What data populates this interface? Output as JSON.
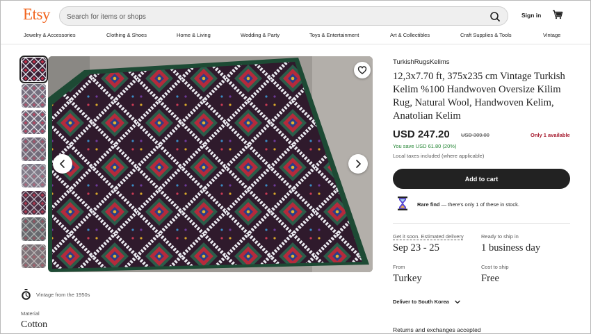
{
  "header": {
    "logo": "Etsy",
    "search_placeholder": "Search for items or shops",
    "sign_in": "Sign in"
  },
  "nav": [
    "Jewelry & Accessories",
    "Clothing & Shoes",
    "Home & Living",
    "Wedding & Party",
    "Toys & Entertainment",
    "Art & Collectibles",
    "Craft Supplies & Tools",
    "Vintage"
  ],
  "listing": {
    "shop_name": "TurkishRugsKelims",
    "title": "12,3x7.70 ft, 375x235 cm Vintage Turkish Kelim %100 Handwoven Oversize Kilim Rug, Natural Wool, Handwoven Kelim, Anatolian Kelim",
    "price": "USD 247.20",
    "original_price": "USD 309.00",
    "availability": "Only 1 available",
    "savings": "You save USD 61.80 (20%)",
    "tax_note": "Local taxes included (where applicable)",
    "add_to_cart": "Add to cart",
    "rare_find_bold": "Rare find",
    "rare_find_text": " — there's only 1 of these in stock.",
    "thumbnail_count": 8,
    "active_thumbnail": 1
  },
  "shipping": {
    "estimate_label": "Get it soon. Estimated delivery",
    "estimate_value": "Sep 23 - 25",
    "ready_label": "Ready to ship in",
    "ready_value": "1 business day",
    "from_label": "From",
    "from_value": "Turkey",
    "cost_label": "Cost to ship",
    "cost_value": "Free",
    "deliver_to": "Deliver to South Korea",
    "returns": "Returns and exchanges accepted"
  },
  "details": {
    "vintage_text": "Vintage from the 1950s",
    "material_label": "Material",
    "material_value": "Cotton"
  },
  "colors": {
    "brand": "#f1641e",
    "button": "#222222",
    "savings": "#258635",
    "availability": "#a61a2e"
  },
  "icons": [
    "search-icon",
    "cart-icon",
    "heart-icon",
    "chevron-left-icon",
    "chevron-right-icon",
    "stopwatch-icon",
    "hourglass-icon",
    "chevron-down-icon"
  ]
}
